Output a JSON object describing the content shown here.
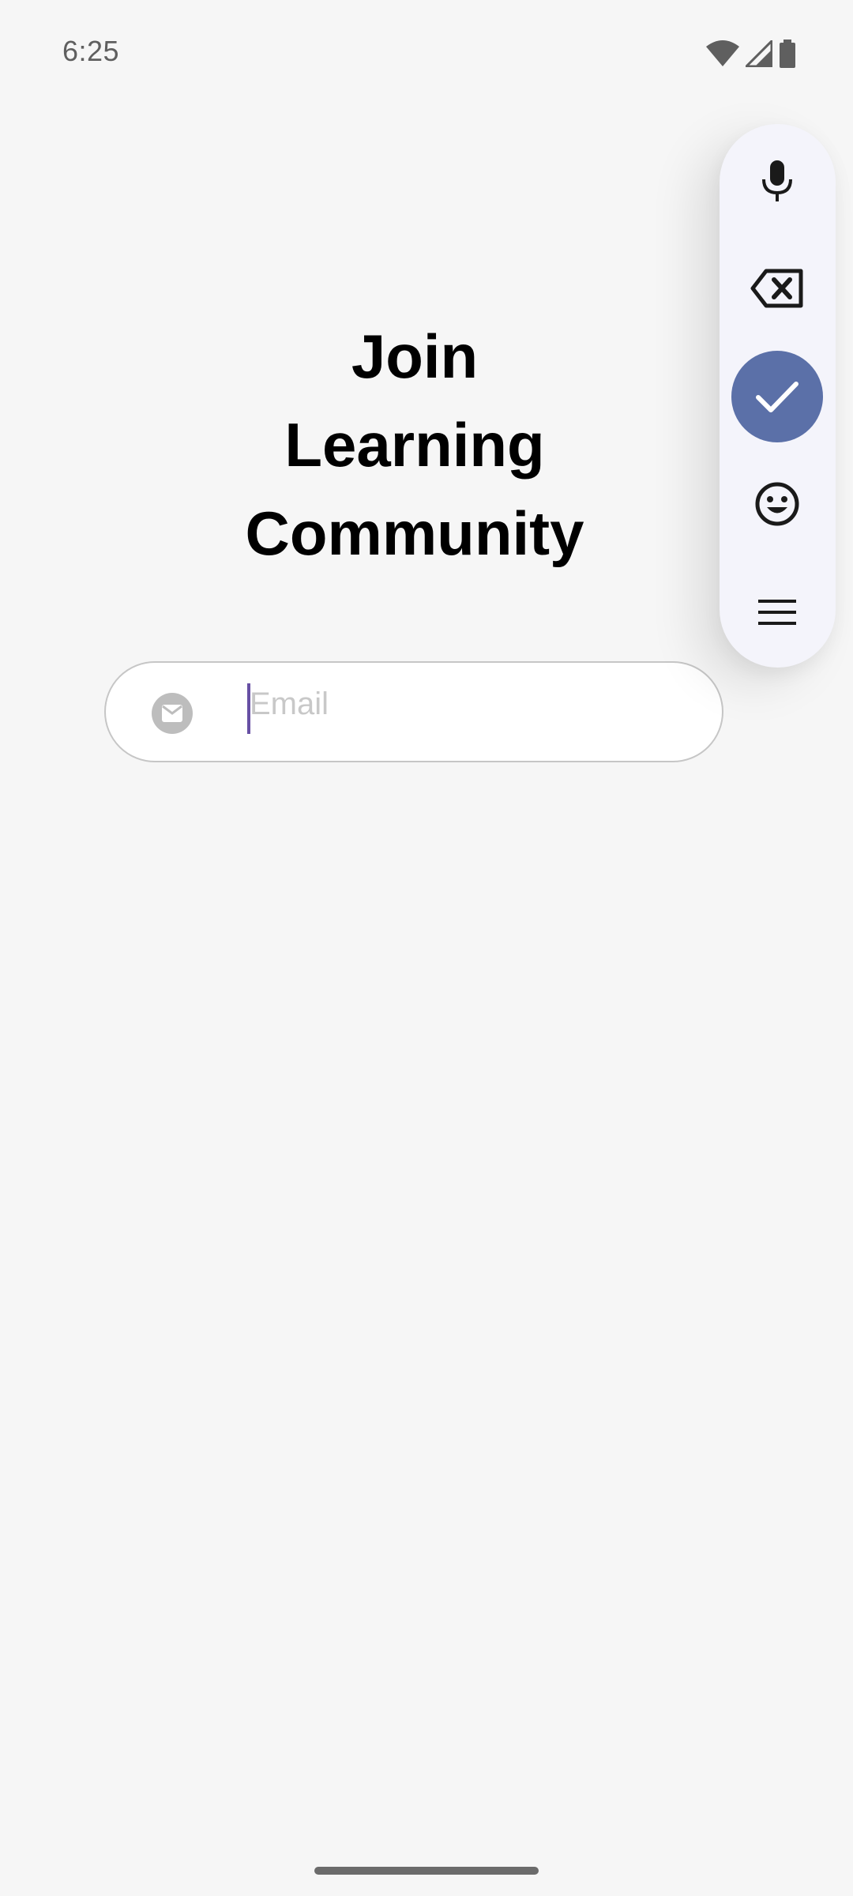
{
  "status_bar": {
    "time": "6:25",
    "icons": [
      "wifi-icon",
      "signal-icon",
      "battery-icon"
    ]
  },
  "heading": {
    "lines": [
      "Join",
      "Learning",
      "Community"
    ]
  },
  "email_field": {
    "placeholder": "Email",
    "value": "",
    "icon": "mail-icon"
  },
  "keyboard_toolbar": {
    "buttons": [
      "microphone-icon",
      "backspace-icon",
      "check-icon",
      "emoji-icon",
      "menu-icon"
    ],
    "accent_color": "#5b70a8",
    "background_color": "#f4f4fb"
  },
  "colors": {
    "page_background": "#f6f6f6",
    "cursor": "#6750a4",
    "placeholder_text": "#c8c8c8"
  }
}
